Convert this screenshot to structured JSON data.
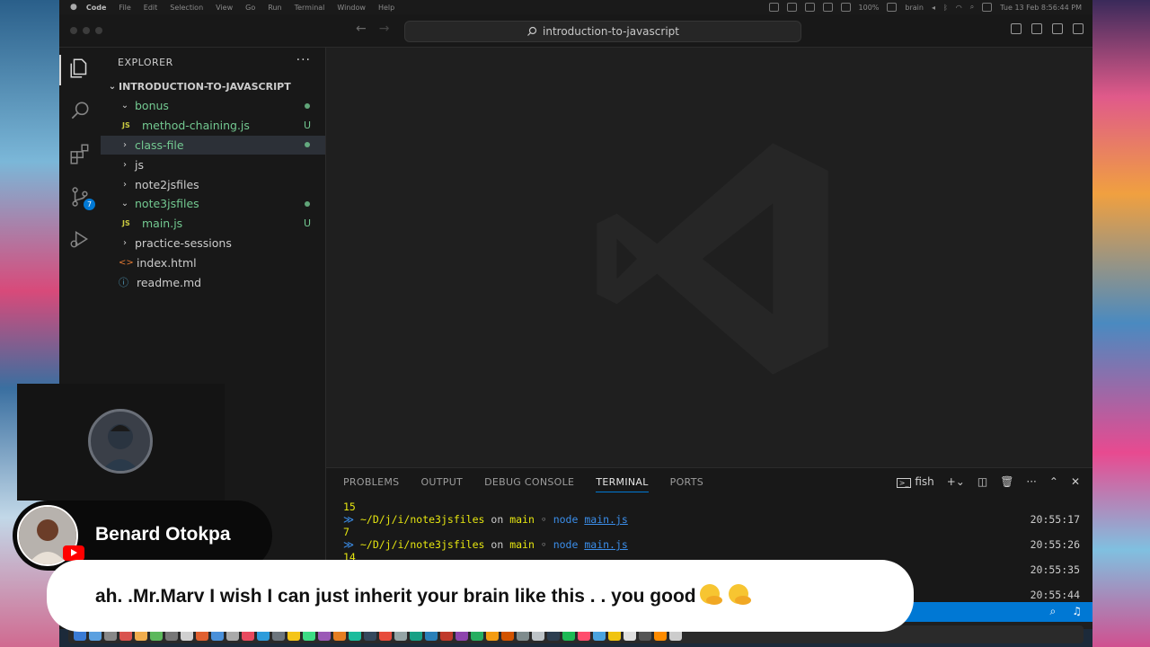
{
  "menubar": {
    "app": "Code",
    "items": [
      "File",
      "Edit",
      "Selection",
      "View",
      "Go",
      "Run",
      "Terminal",
      "Window",
      "Help"
    ],
    "battery": "100%",
    "user": "brain",
    "clock": "Tue 13 Feb  8:56:44 PM"
  },
  "titlebar": {
    "search_text": "introduction-to-javascript"
  },
  "activity": {
    "scm_badge": "7"
  },
  "explorer": {
    "title": "EXPLORER",
    "root": "INTRODUCTION-TO-JAVASCRIPT",
    "items": [
      {
        "label": "bonus",
        "type": "folder-open",
        "indent": 1,
        "status": "dot",
        "color": "green"
      },
      {
        "label": "method-chaining.js",
        "type": "js",
        "indent": 2,
        "status": "U",
        "color": "green"
      },
      {
        "label": "class-file",
        "type": "folder",
        "indent": 1,
        "status": "dot",
        "color": "green",
        "selected": true
      },
      {
        "label": "js",
        "type": "folder",
        "indent": 1
      },
      {
        "label": "note2jsfiles",
        "type": "folder",
        "indent": 1
      },
      {
        "label": "note3jsfiles",
        "type": "folder-open",
        "indent": 1,
        "status": "dot",
        "color": "green"
      },
      {
        "label": "main.js",
        "type": "js",
        "indent": 2,
        "status": "U",
        "color": "green"
      },
      {
        "label": "practice-sessions",
        "type": "folder",
        "indent": 1
      },
      {
        "label": "index.html",
        "type": "html",
        "indent": 1
      },
      {
        "label": "readme.md",
        "type": "info",
        "indent": 1
      }
    ]
  },
  "panel": {
    "tabs": [
      "PROBLEMS",
      "OUTPUT",
      "DEBUG CONSOLE",
      "TERMINAL",
      "PORTS"
    ],
    "active_tab": "TERMINAL",
    "shell": "fish",
    "lines": [
      {
        "kind": "out",
        "text": "15"
      },
      {
        "kind": "prompt",
        "path": "~/D/j/i/note3jsfiles",
        "on": "on",
        "branch": "main",
        "sep": "◦",
        "cmd": "node",
        "file": "main.js",
        "time": "20:55:17"
      },
      {
        "kind": "out",
        "text": "7"
      },
      {
        "kind": "prompt",
        "path": "~/D/j/i/note3jsfiles",
        "on": "on",
        "branch": "main",
        "sep": "◦",
        "cmd": "node",
        "file": "main.js",
        "time": "20:55:26"
      },
      {
        "kind": "out",
        "text": "14"
      },
      {
        "kind": "time",
        "time": "20:55:35"
      },
      {
        "kind": "time",
        "time": "20:55:44"
      }
    ]
  },
  "overlay": {
    "name": "Benard Otokpa",
    "message": "ah. .Mr.Marv I wish I can just inherit your brain like this . . you good"
  },
  "colors": {
    "accent": "#0078d4",
    "git_untracked": "#73c991",
    "js_icon": "#cbcb41"
  }
}
